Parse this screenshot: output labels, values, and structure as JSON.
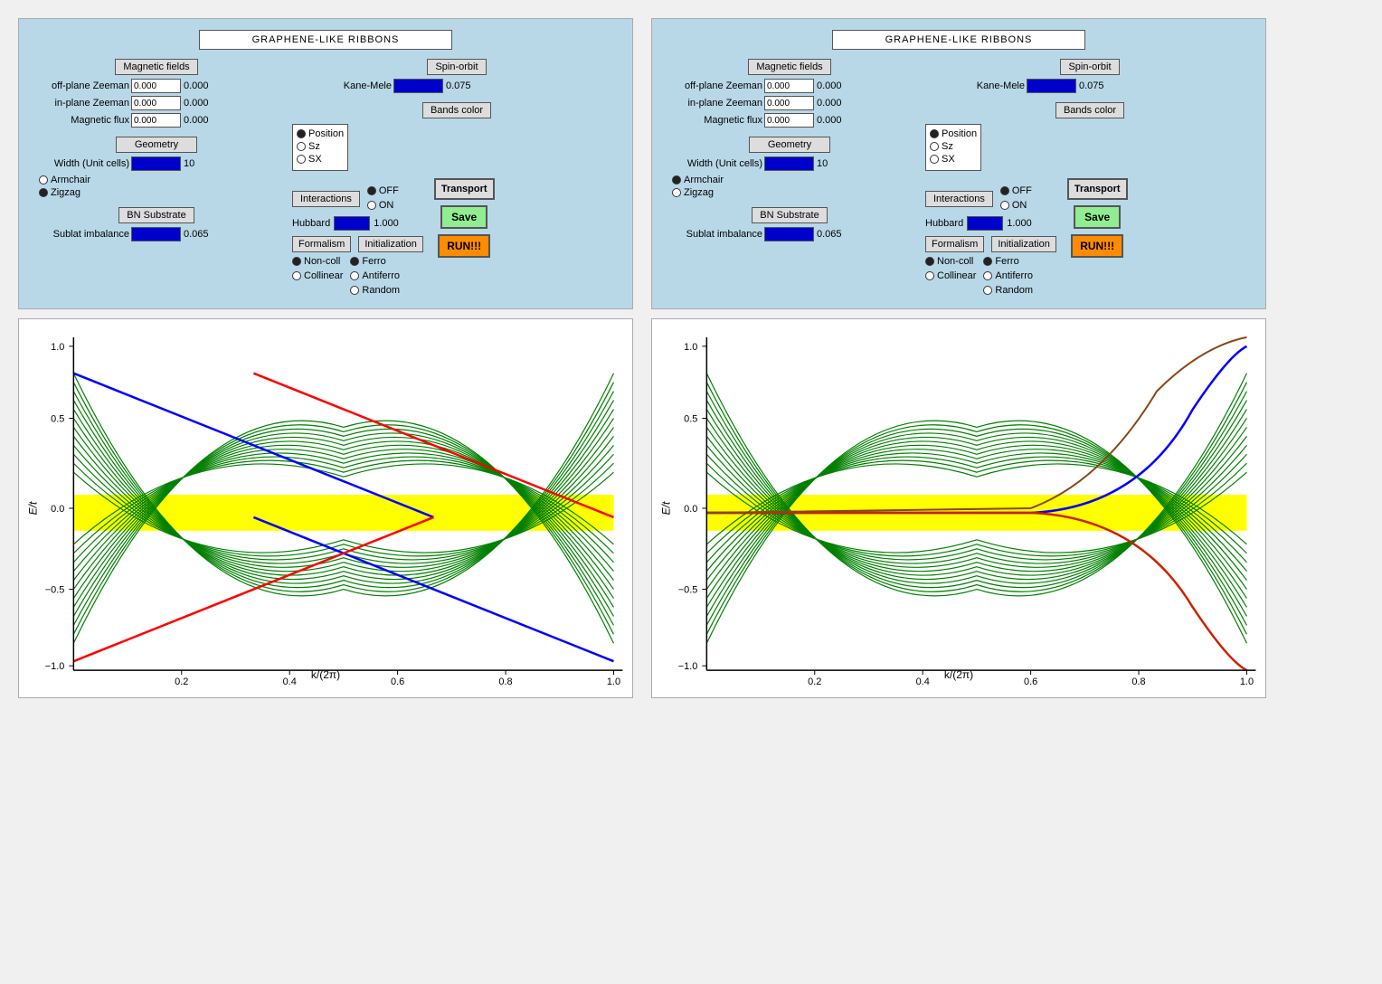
{
  "app": {
    "title": "GRAPHENE-LIKE RIBBONS"
  },
  "panel1": {
    "title": "GRAPHENE-LIKE RIBBONS",
    "magnetic_fields_label": "Magnetic fields",
    "off_plane_zeeman_label": "off-plane Zeeman",
    "off_plane_zeeman_value": "0.000",
    "in_plane_zeeman_label": "in-plane Zeeman",
    "in_plane_zeeman_value": "0.000",
    "magnetic_flux_label": "Magnetic flux",
    "magnetic_flux_value": "0.000",
    "spin_orbit_label": "Spin-orbit",
    "kane_mele_label": "Kane-Mele",
    "kane_mele_value": "0.075",
    "bands_color_label": "Bands color",
    "bands_color_options": [
      "Position",
      "Sz",
      "SX"
    ],
    "bands_color_selected": "Position",
    "geometry_label": "Geometry",
    "width_label": "Width (Unit cells)",
    "width_value": "10",
    "armchair_label": "Armchair",
    "zigzag_label": "Zigzag",
    "zigzag_selected": true,
    "bn_substrate_label": "BN Substrate",
    "sublat_imbalance_label": "Sublat imbalance",
    "sublat_imbalance_value": "0.065",
    "interactions_label": "Interactions",
    "off_label": "OFF",
    "on_label": "ON",
    "on_selected": false,
    "off_selected": true,
    "hubbard_label": "Hubbard",
    "hubbard_value": "1.000",
    "transport_label": "Transport",
    "save_label": "Save",
    "run_label": "RUN!!!",
    "formalism_label": "Formalism",
    "initialization_label": "Initialization",
    "non_coll_label": "Non-coll",
    "collinear_label": "Collinear",
    "non_coll_selected": true,
    "ferro_label": "Ferro",
    "antiferro_label": "Antiferro",
    "random_label": "Random",
    "ferro_selected": true
  },
  "panel2": {
    "title": "GRAPHENE-LIKE RIBBONS",
    "magnetic_fields_label": "Magnetic fields",
    "off_plane_zeeman_label": "off-plane Zeeman",
    "off_plane_zeeman_value": "0.000",
    "in_plane_zeeman_label": "in-plane Zeeman",
    "in_plane_zeeman_value": "0.000",
    "magnetic_flux_label": "Magnetic flux",
    "magnetic_flux_value": "0.000",
    "spin_orbit_label": "Spin-orbit",
    "kane_mele_label": "Kane-Mele",
    "kane_mele_value": "0.075",
    "bands_color_label": "Bands color",
    "bands_color_options": [
      "Position",
      "Sz",
      "SX"
    ],
    "bands_color_selected": "Position",
    "geometry_label": "Geometry",
    "width_label": "Width (Unit cells)",
    "width_value": "10",
    "armchair_label": "Armchair",
    "zigzag_label": "Zigzag",
    "zigzag_selected": false,
    "armchair_selected": true,
    "bn_substrate_label": "BN Substrate",
    "sublat_imbalance_label": "Sublat imbalance",
    "sublat_imbalance_value": "0.065",
    "interactions_label": "Interactions",
    "off_label": "OFF",
    "on_label": "ON",
    "on_selected": false,
    "off_selected": true,
    "hubbard_label": "Hubbard",
    "hubbard_value": "1.000",
    "transport_label": "Transport",
    "save_label": "Save",
    "run_label": "RUN!!!",
    "formalism_label": "Formalism",
    "initialization_label": "Initialization",
    "non_coll_label": "Non-coll",
    "collinear_label": "Collinear",
    "non_coll_selected": true,
    "ferro_label": "Ferro",
    "antiferro_label": "Antiferro",
    "random_label": "Random",
    "ferro_selected": true
  },
  "chart1": {
    "y_label": "E/t",
    "x_label": "k/(2π)",
    "y_ticks": [
      "1.0",
      "0.5",
      "0.0",
      "-0.5",
      "-1.0"
    ],
    "x_ticks": [
      "0.2",
      "0.4",
      "0.6",
      "0.8",
      "1.0"
    ]
  },
  "chart2": {
    "y_label": "E/t",
    "x_label": "k/(2π)",
    "y_ticks": [
      "1.0",
      "0.5",
      "0.0",
      "-0.5",
      "-1.0"
    ],
    "x_ticks": [
      "0.2",
      "0.4",
      "0.6",
      "0.8",
      "1.0"
    ]
  }
}
